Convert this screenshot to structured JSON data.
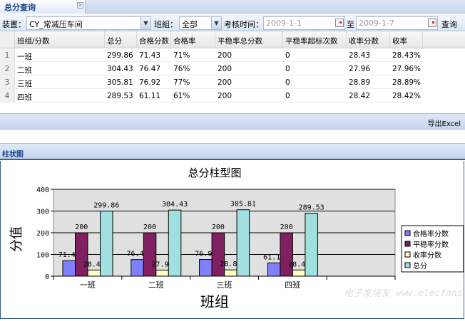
{
  "tab": {
    "title": "总分查询",
    "close_icon": "close-icon"
  },
  "toolbar": {
    "device_label": "装置：",
    "device_value": "CY_常减压车间",
    "team_label": "班組：",
    "team_value": "全部",
    "time_label": "考核时间：",
    "date_from": "2009-1-1",
    "to_label": "至",
    "date_to": "2009-1-7",
    "query_label": "查询"
  },
  "table": {
    "columns": [
      "班组/分数",
      "总分",
      "合格分数",
      "合格率",
      "平稳率总分数",
      "平稳率超标次数",
      "收率分数",
      "收率"
    ],
    "rows": [
      {
        "n": "1",
        "cells": [
          "一班",
          "299.86",
          "71.43",
          "71%",
          "200",
          "0",
          "28.43",
          "28.43%"
        ]
      },
      {
        "n": "2",
        "cells": [
          "二班",
          "304.43",
          "76.47",
          "76%",
          "200",
          "0",
          "27.96",
          "27.96%"
        ]
      },
      {
        "n": "3",
        "cells": [
          "三班",
          "305.81",
          "76.92",
          "77%",
          "200",
          "0",
          "28.89",
          "28.89%"
        ]
      },
      {
        "n": "4",
        "cells": [
          "四班",
          "289.53",
          "61.11",
          "61%",
          "200",
          "0",
          "28.42",
          "28.42%"
        ]
      }
    ]
  },
  "export_label": "导出Excel",
  "chart_panel_title": "柱状图",
  "watermark": "电子发烧友 www.elecfans.com",
  "chart_data": {
    "type": "bar",
    "title": "总分柱型图",
    "xlabel": "班组",
    "ylabel": "分值",
    "categories": [
      "一班",
      "二班",
      "三班",
      "四班"
    ],
    "ylim": [
      0,
      400
    ],
    "yticks": [
      "0",
      "100",
      "200",
      "300",
      "400"
    ],
    "grid": true,
    "legend": "right",
    "series": [
      {
        "name": "合格率分数",
        "values": [
          71.43,
          76.47,
          76.92,
          61.11
        ],
        "color": "#8080ff",
        "labels": [
          "71.43",
          "76.47",
          "76.92",
          "61.11"
        ]
      },
      {
        "name": "平稳率分数",
        "values": [
          200,
          200,
          200,
          200
        ],
        "color": "#802060",
        "labels": [
          "200",
          "200",
          "200",
          "200"
        ]
      },
      {
        "name": "收率分数",
        "values": [
          28.43,
          27.96,
          28.89,
          28.42
        ],
        "color": "#ffffc0",
        "labels": [
          "28.43",
          "27.96",
          "28.89",
          "28.42"
        ]
      },
      {
        "name": "总分",
        "values": [
          299.86,
          304.43,
          305.81,
          289.53
        ],
        "color": "#a0e0e0",
        "labels": [
          "299.86",
          "304.43",
          "305.81",
          "289.53"
        ]
      }
    ]
  }
}
